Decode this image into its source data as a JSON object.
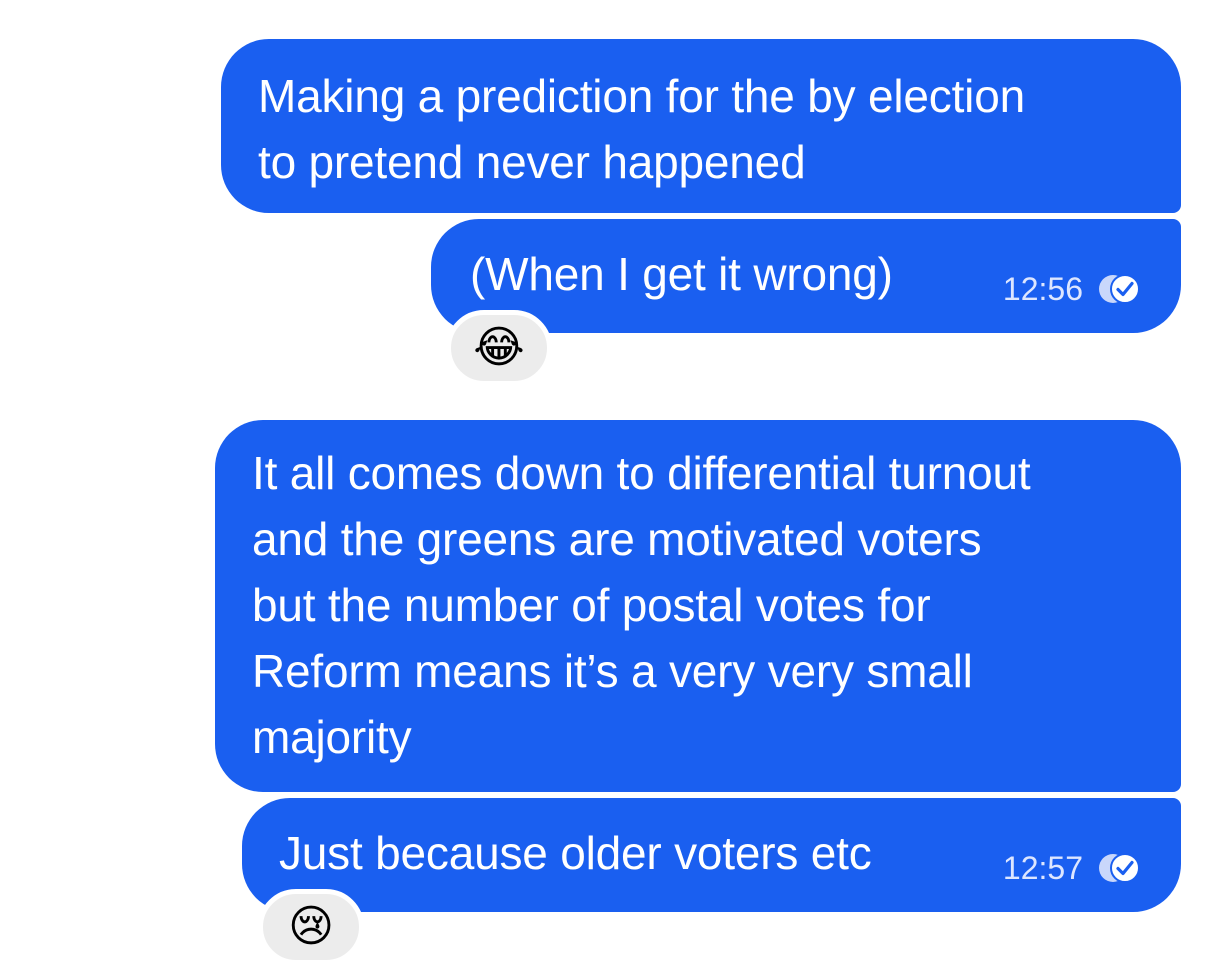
{
  "messages": [
    {
      "text": "Making a prediction for the by election\nto pretend never happened"
    },
    {
      "text": "(When I get it wrong)",
      "time": "12:56",
      "status_icon": "double-check-read-icon",
      "reaction": "😂"
    },
    {
      "text": "It all comes down to differential turnout\nand the greens are motivated voters\nbut the number of postal votes for\nReform means it’s a very very small\nmajority"
    },
    {
      "text": "Just because older voters etc",
      "time": "12:57",
      "status_icon": "double-check-read-icon",
      "reaction": "😢"
    }
  ],
  "colors": {
    "bubble": "#1a5ff0",
    "bubble_text": "#ffffff",
    "meta_text": "#dde6ff",
    "reaction_bg": "#ececec",
    "background": "#ffffff"
  }
}
